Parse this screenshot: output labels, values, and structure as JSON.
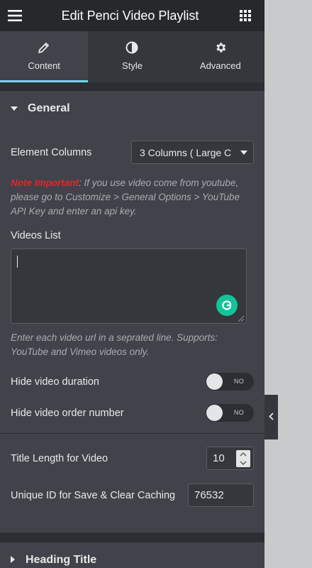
{
  "header": {
    "title": "Edit Penci Video Playlist",
    "menu_icon": "hamburger-icon",
    "apps_icon": "grid-icon"
  },
  "tabs": [
    {
      "label": "Content",
      "icon": "pencil-icon",
      "active": true
    },
    {
      "label": "Style",
      "icon": "contrast-icon",
      "active": false
    },
    {
      "label": "Advanced",
      "icon": "gear-icon",
      "active": false
    }
  ],
  "general": {
    "title": "General",
    "element_columns_label": "Element Columns",
    "element_columns_value": "3 Columns ( Large C",
    "note_strong": "Note Important",
    "note_text": ": If you use video come from youtube, please go to Customize > General Options > YouTube API Key and enter an api key.",
    "videos_list_label": "Videos List",
    "videos_list_value": "",
    "videos_help": "Enter each video url in a seprated line. Supports: YouTube and Vimeo videos only.",
    "hide_duration_label": "Hide video duration",
    "hide_duration_state": "NO",
    "hide_order_label": "Hide video order number",
    "hide_order_state": "NO",
    "title_length_label": "Title Length for Video",
    "title_length_value": "10",
    "unique_id_label": "Unique ID for Save & Clear Caching",
    "unique_id_value": "76532"
  },
  "heading_section": {
    "title": "Heading Title"
  },
  "colors": {
    "panel": "#34383c",
    "section": "#404349",
    "accent": "#71d7f7",
    "note_red": "#e8242b",
    "grammarly": "#15c39a"
  }
}
